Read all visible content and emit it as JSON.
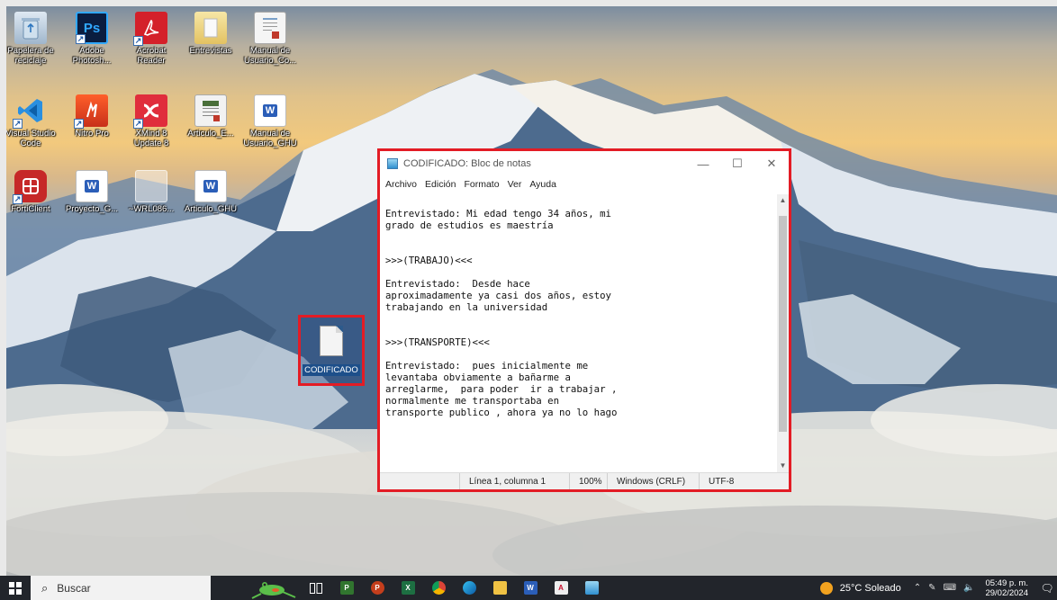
{
  "desktop_icons": [
    {
      "label": "Papelera de reciclaje",
      "icon": "recycle-bin-icon"
    },
    {
      "label": "Adobe Photosh...",
      "icon": "photoshop-icon"
    },
    {
      "label": "Acrobat Reader",
      "icon": "acrobat-icon"
    },
    {
      "label": "Entrevistas",
      "icon": "folder-icon"
    },
    {
      "label": "Manual de Usuario_Co...",
      "icon": "document-icon"
    },
    {
      "label": "Visual Studio Code",
      "icon": "vscode-icon"
    },
    {
      "label": "Nitro Pro",
      "icon": "nitro-icon"
    },
    {
      "label": "XMind 8 Update 8",
      "icon": "xmind-icon"
    },
    {
      "label": "Articulo_E...",
      "icon": "document-icon"
    },
    {
      "label": "Manual de Usuario_GHU",
      "icon": "word-icon"
    },
    {
      "label": "FortiClient",
      "icon": "forticlient-icon"
    },
    {
      "label": "Proyecto_G...",
      "icon": "word-icon"
    },
    {
      "label": "~WRL086...",
      "icon": "file-icon"
    },
    {
      "label": "Articulo_GHU",
      "icon": "word-icon"
    }
  ],
  "selected_file": {
    "label": "CODIFICADO"
  },
  "notepad": {
    "title": "CODIFICADO: Bloc de notas",
    "menu": [
      "Archivo",
      "Edición",
      "Formato",
      "Ver",
      "Ayuda"
    ],
    "content": "Entrevistado: Mi edad tengo 34 años, mi\ngrado de estudios es maestría\n\n\n>>>(TRABAJO)<<<\n\nEntrevistado:  Desde hace\naproximadamente ya casi dos años, estoy\ntrabajando en la universidad\n\n\n>>>(TRANSPORTE)<<<\n\nEntrevistado:  pues inicialmente me\nlevantaba obviamente a bañarme a\narreglarme,  para poder  ir a trabajar ,\nnormalmente me transportaba en\ntransporte publico , ahora ya no lo hago",
    "status": {
      "position": "Línea 1, columna 1",
      "zoom": "100%",
      "line_ending": "Windows (CRLF)",
      "encoding": "UTF-8"
    }
  },
  "taskbar": {
    "search_placeholder": "Buscar",
    "weather": "25°C  Soleado",
    "time": "05:49 p. m.",
    "date": "29/02/2024"
  }
}
